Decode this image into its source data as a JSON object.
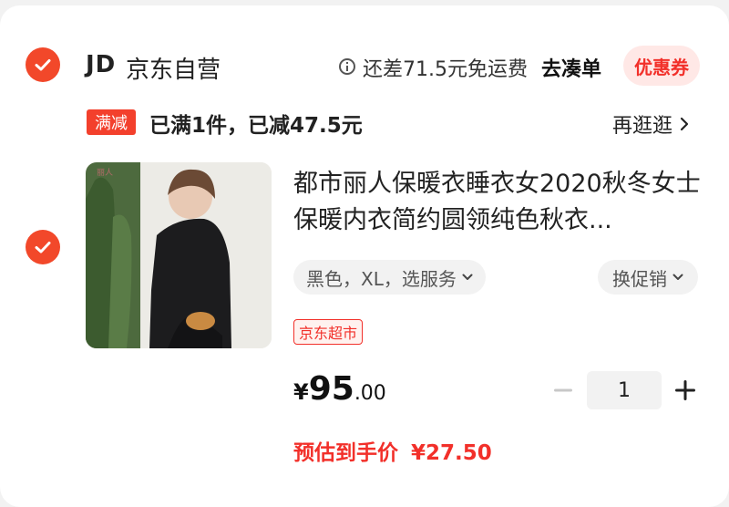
{
  "shop": {
    "logo_text": "JD",
    "name": "京东自营",
    "shipping_note": "还差71.5元免运费",
    "add_items_label": "去凑单",
    "coupon_label": "优惠券"
  },
  "promotion": {
    "tag": "满减",
    "text": "已满1件，已减47.5元",
    "browse_label": "再逛逛"
  },
  "product": {
    "title": "都市丽人保暖衣睡衣女2020秋冬女士保暖内衣简约圆领纯色秋衣...",
    "spec": "黑色，XL，选服务",
    "change_promo_label": "换促销",
    "badge": "京东超市",
    "price_symbol": "¥",
    "price_int": "95",
    "price_dec": ".00",
    "quantity": "1",
    "estimated_label": "预估到手价",
    "estimated_price": "¥27.50"
  },
  "icons": {
    "shop_checkbox": "check-circle-icon",
    "item_checkbox": "check-circle-icon",
    "info": "info-icon",
    "chevron_right": "chevron-right-icon",
    "chevron_down": "chevron-down-icon",
    "minus": "minus-icon",
    "plus": "plus-icon"
  },
  "colors": {
    "accent": "#f2482a",
    "price_red": "#f2302a",
    "coupon_bg": "#ffe8e6"
  }
}
